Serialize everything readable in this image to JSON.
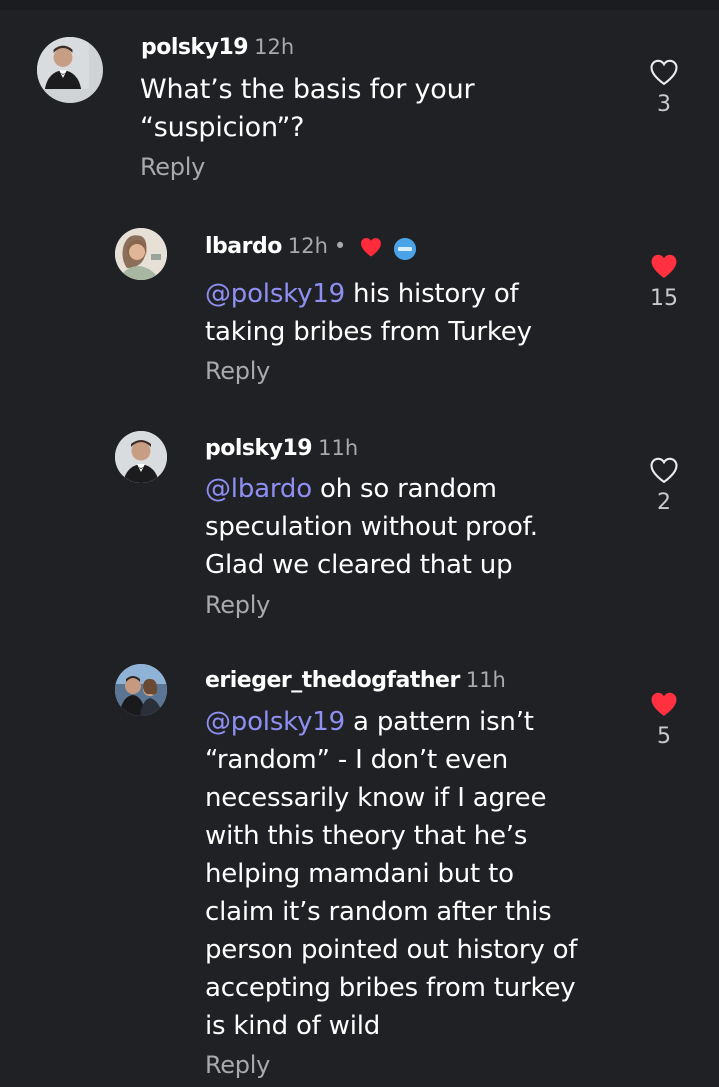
{
  "comments": [
    {
      "username": "polsky19",
      "time": "12h",
      "text": "What’s the basis for your “suspicion”?",
      "mention": "",
      "reply_label": "Reply",
      "likes": "3",
      "liked": false
    },
    {
      "username": "lbardo",
      "time": "12h",
      "dot": "•",
      "mention": "@polsky19",
      "text": " his history of taking bribes from Turkey",
      "reply_label": "Reply",
      "likes": "15",
      "liked": true
    },
    {
      "username": "polsky19",
      "time": "11h",
      "mention": "@lbardo",
      "text": " oh so random speculation without proof. Glad we cleared that up",
      "reply_label": "Reply",
      "likes": "2",
      "liked": false
    },
    {
      "username": "erieger_thedogfather",
      "time": "11h",
      "mention": "@polsky19",
      "text": " a pattern isn’t “random” - I don’t even necessarily know if I agree with this theory that he’s helping mamdani but to claim it’s random after this person pointed out history of accepting bribes from turkey is kind of wild",
      "reply_label": "Reply",
      "likes": "5",
      "liked": true
    }
  ],
  "icons": {
    "heart_outline": "heart-outline-icon",
    "heart_filled": "heart-filled-icon",
    "badge": "verified-badge-icon"
  },
  "colors": {
    "background": "#202124",
    "mention": "#8e8ff2",
    "like_red": "#ff3040",
    "muted": "#a8a9ad"
  }
}
